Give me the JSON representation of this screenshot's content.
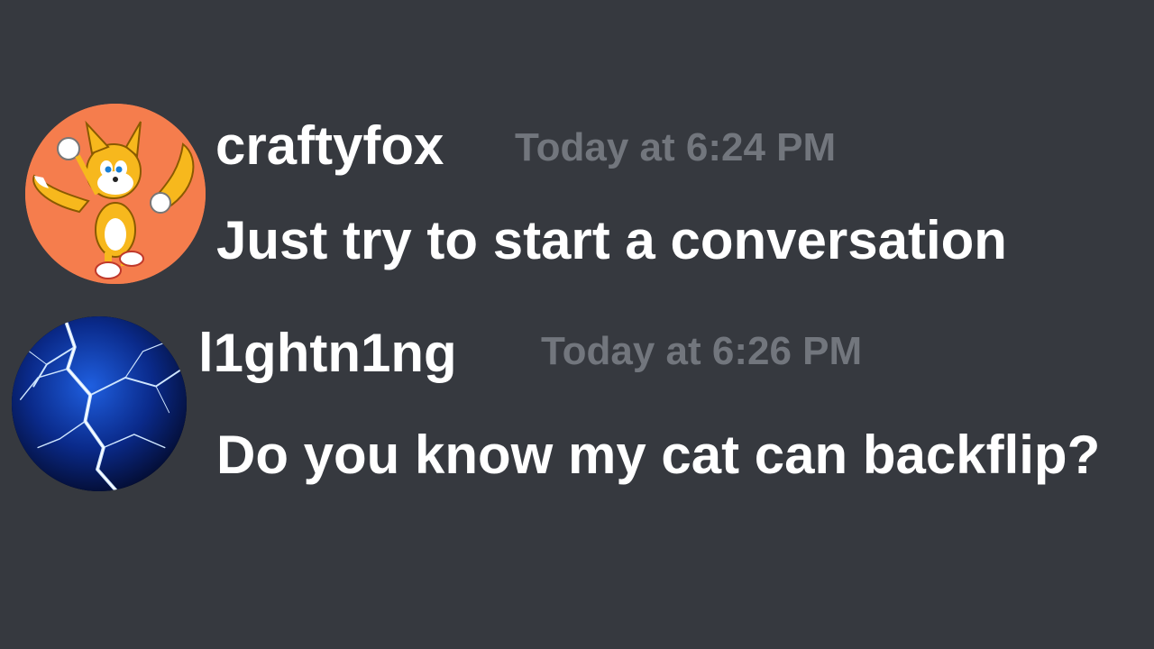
{
  "messages": [
    {
      "username": "craftyfox",
      "timestamp": "Today at 6:24 PM",
      "content": "Just try to start a conversation",
      "avatar_icon": "fox-avatar-icon",
      "avatar_color": "#f57d4d"
    },
    {
      "username": "l1ghtn1ng",
      "timestamp": "Today at 6:26 PM",
      "content": "Do you know my cat can backflip?",
      "avatar_icon": "lightning-avatar-icon",
      "avatar_color": "#0a2a8a"
    }
  ],
  "colors": {
    "background": "#36393f",
    "username": "#ffffff",
    "timestamp": "#72767d",
    "content": "#ffffff"
  }
}
